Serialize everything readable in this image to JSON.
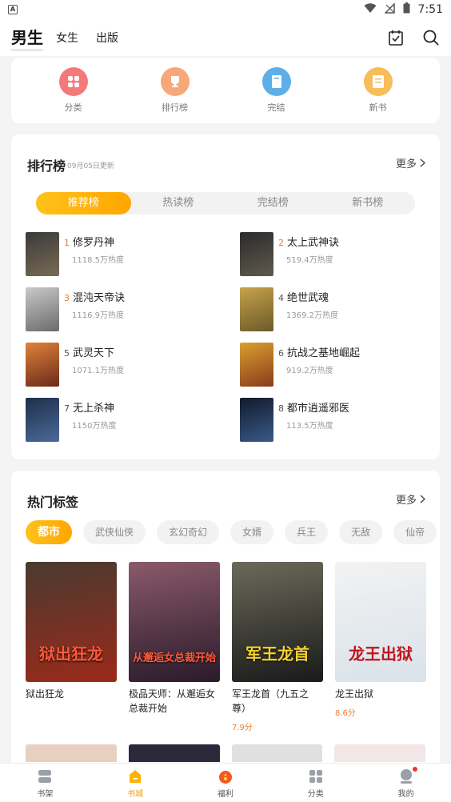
{
  "status": {
    "time": "7:51",
    "left_icon": "A"
  },
  "header": {
    "tabs": [
      "男生",
      "女生",
      "出版"
    ],
    "active_tab": 0,
    "icons": [
      "checkin-icon",
      "search-icon"
    ]
  },
  "categories": [
    {
      "label": "分类",
      "color": "#f36b6b",
      "icon": "grid-icon"
    },
    {
      "label": "排行榜",
      "color": "#f5a06a",
      "icon": "trophy-icon"
    },
    {
      "label": "完结",
      "color": "#4fa8e8",
      "icon": "book-icon"
    },
    {
      "label": "新书",
      "color": "#f5b347",
      "icon": "newbook-icon"
    }
  ],
  "ranking": {
    "title": "排行榜",
    "subtitle": "09月05日更新",
    "more": "更多",
    "tabs": [
      "推荐榜",
      "热读榜",
      "完结榜",
      "新书榜"
    ],
    "active_tab": 0,
    "items": [
      {
        "rank": "1",
        "title": "修罗丹神",
        "heat": "1118.5万热度",
        "cover": [
          "#3a3a3a",
          "#7a6a55"
        ]
      },
      {
        "rank": "2",
        "title": "太上武神诀",
        "heat": "519.4万热度",
        "cover": [
          "#2b2b2b",
          "#5f5a4e"
        ]
      },
      {
        "rank": "3",
        "title": "混沌天帝诀",
        "heat": "1116.9万热度",
        "cover": [
          "#c9c9c9",
          "#6b6b6b"
        ]
      },
      {
        "rank": "4",
        "title": "绝世武魂",
        "heat": "1369.2万热度",
        "cover": [
          "#c7a24a",
          "#6b5a2a"
        ]
      },
      {
        "rank": "5",
        "title": "武灵天下",
        "heat": "1071.1万热度",
        "cover": [
          "#e0823a",
          "#6a2a1a"
        ]
      },
      {
        "rank": "6",
        "title": "抗战之基地崛起",
        "heat": "919.2万热度",
        "cover": [
          "#d9a030",
          "#8a3a1a"
        ]
      },
      {
        "rank": "7",
        "title": "无上杀神",
        "heat": "1150万热度",
        "cover": [
          "#1f2f4a",
          "#4a6a9a"
        ]
      },
      {
        "rank": "8",
        "title": "都市逍遥邪医",
        "heat": "113.5万热度",
        "cover": [
          "#111a2a",
          "#3a5a8a"
        ]
      }
    ]
  },
  "tags": {
    "title": "热门标签",
    "more": "更多",
    "items": [
      "都市",
      "武侠仙侠",
      "玄幻奇幻",
      "女婿",
      "兵王",
      "无敌",
      "仙帝"
    ],
    "active": 0
  },
  "books": [
    {
      "title": "狱出狂龙",
      "score": "",
      "cover_text": "狱出狂龙",
      "cover": [
        "#4a3a30",
        "#9a2a1a"
      ]
    },
    {
      "title": "极品天师：从邂逅女总裁开始",
      "score": "",
      "cover_text": "从邂逅女总裁开始",
      "cover": [
        "#8a5a6a",
        "#2a1a2a"
      ]
    },
    {
      "title": "军王龙首（九五之尊）",
      "score": "7.9分",
      "cover_text": "军王龙首",
      "cover": [
        "#6a6a5a",
        "#1a1a1a"
      ]
    },
    {
      "title": "龙王出狱",
      "score": "8.6分",
      "cover_text": "龙王出狱",
      "cover": [
        "#f2f2f2",
        "#d9e2ea"
      ]
    }
  ],
  "books_row2_colors": [
    "#e8cfc0",
    "#2a2a3a",
    "#e0e0e0",
    "#f2e6e6"
  ],
  "bottom_nav": [
    {
      "label": "书架",
      "icon": "shelf-icon"
    },
    {
      "label": "书城",
      "icon": "store-icon"
    },
    {
      "label": "福利",
      "icon": "gift-icon"
    },
    {
      "label": "分类",
      "icon": "category-icon"
    },
    {
      "label": "我的",
      "icon": "profile-icon"
    }
  ],
  "active_nav": 1
}
